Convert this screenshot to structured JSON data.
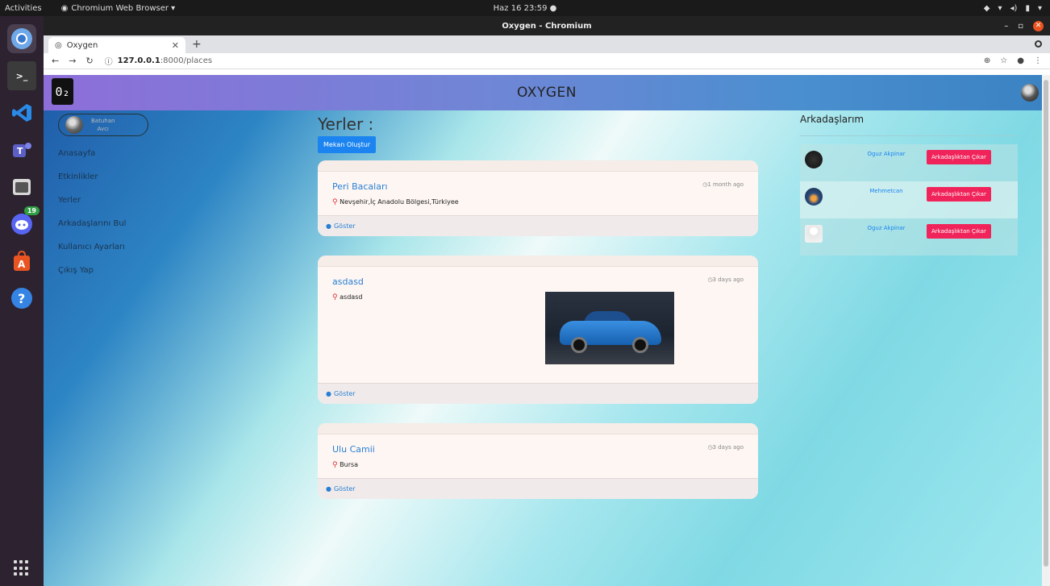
{
  "os": {
    "activities": "Activities",
    "app_menu": "Chromium Web Browser ▾",
    "clock": "Haz 16  23:59  ●"
  },
  "dock": {
    "discord_badge": "19"
  },
  "browser": {
    "window_title": "Oxygen - Chromium",
    "tab_title": "Oxygen",
    "url_host": "127.0.0.1",
    "url_path": ":8000/places"
  },
  "site": {
    "logo_text": "0₂",
    "brand": "OXYGEN"
  },
  "sidebar": {
    "user_name_line1": "Batuhan",
    "user_name_line2": "Avcı",
    "items": [
      {
        "label": "Anasayfa"
      },
      {
        "label": "Etkinlikler"
      },
      {
        "label": "Yerler"
      },
      {
        "label": "Arkadaşlarını Bul"
      },
      {
        "label": "Kullanıcı Ayarları"
      },
      {
        "label": "Çıkış Yap"
      }
    ]
  },
  "main": {
    "title": "Yerler :",
    "create_button": "Mekan Oluştur",
    "show_label": "Göster",
    "places": [
      {
        "title": "Peri Bacaları",
        "location": "Nevşehir,İç Anadolu Bölgesi,Türkiyee",
        "time": "1 month ago"
      },
      {
        "title": "asdasd",
        "location": "asdasd",
        "time": "3 days ago"
      },
      {
        "title": "Ulu Camii",
        "location": "Bursa",
        "time": "3 days ago"
      }
    ]
  },
  "friends": {
    "title": "Arkadaşlarım",
    "remove_label": "Arkadaşlıktan Çıkar",
    "items": [
      {
        "name": "Oguz Akpinar"
      },
      {
        "name": "Mehmetcan"
      },
      {
        "name": "Oguz Akpinar"
      }
    ]
  },
  "colors": {
    "accent": "#1b84f0",
    "danger": "#f0245a",
    "header_start": "#8e6ed9",
    "header_end": "#3a82c2"
  }
}
